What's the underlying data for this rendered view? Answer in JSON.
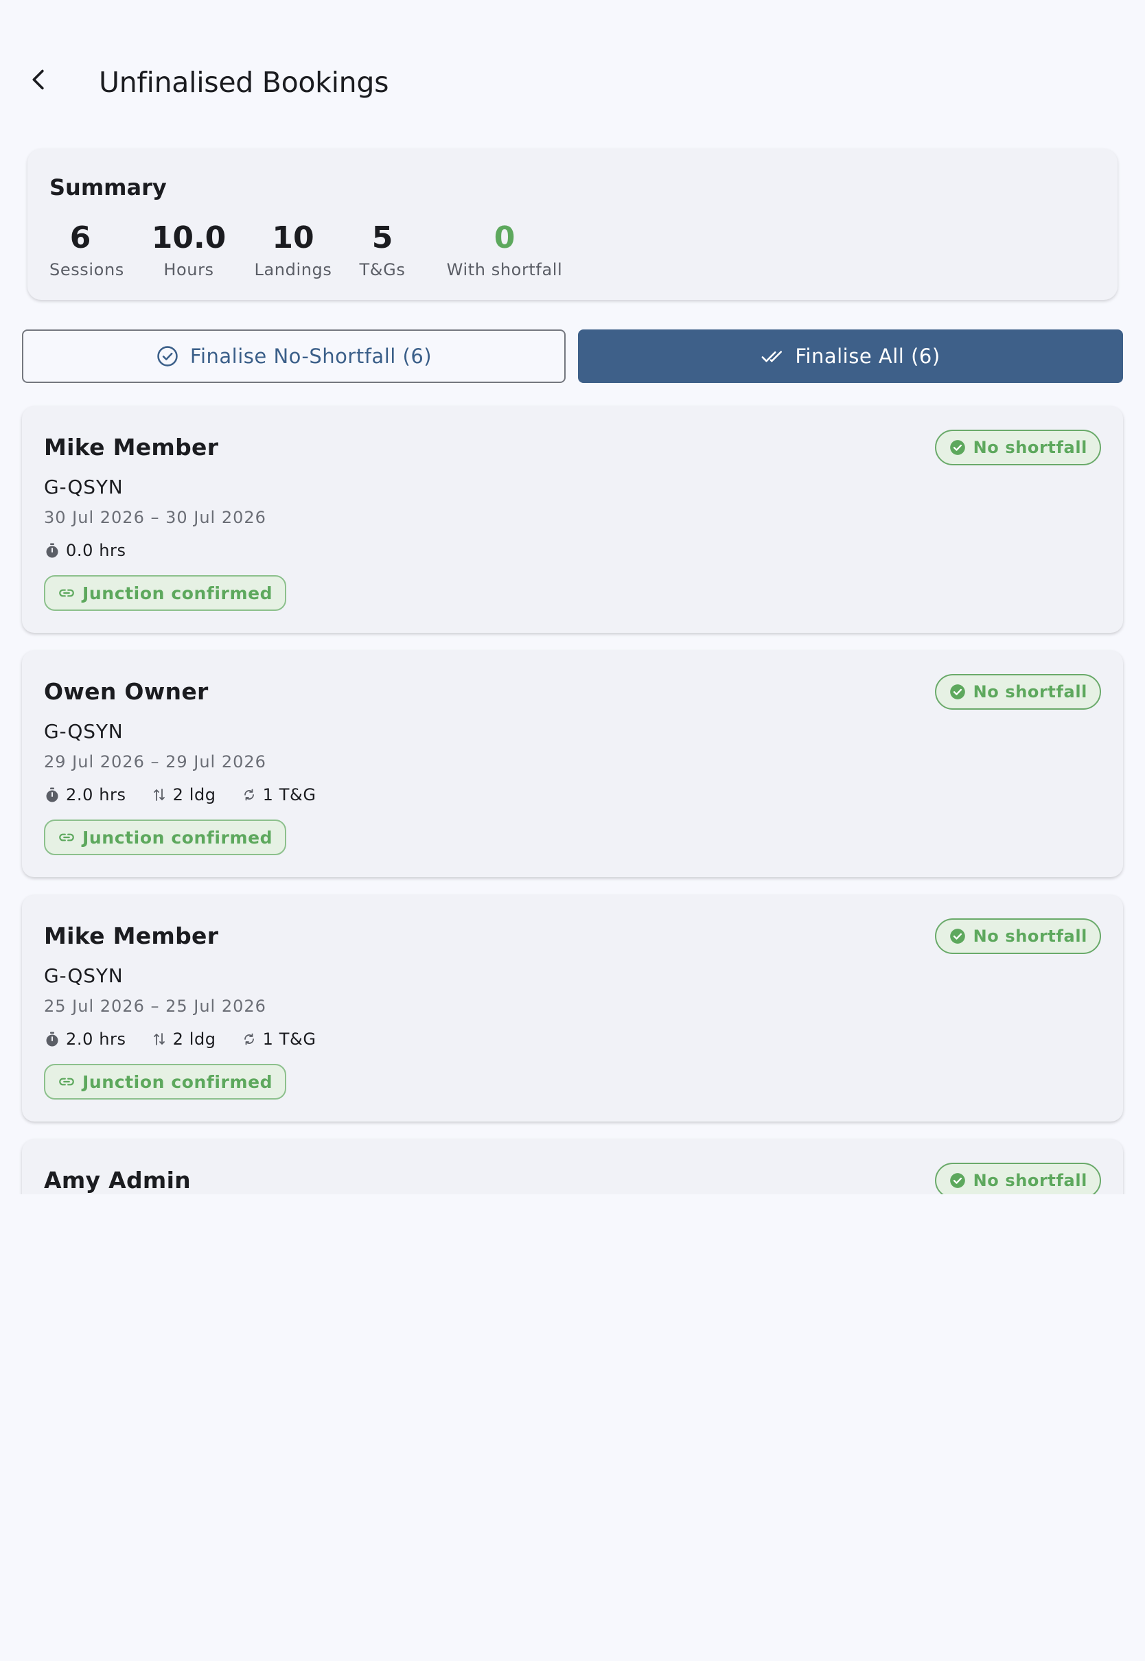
{
  "header": {
    "title": "Unfinalised Bookings",
    "back_icon": "arrow-back-icon"
  },
  "summary": {
    "title": "Summary",
    "stats": [
      {
        "value": "6",
        "label": "Sessions"
      },
      {
        "value": "10.0",
        "label": "Hours"
      },
      {
        "value": "10",
        "label": "Landings"
      },
      {
        "value": "5",
        "label": "T&Gs"
      },
      {
        "value": "0",
        "label": "With shortfall"
      }
    ],
    "shortfall_color": "#5da85d"
  },
  "actions": {
    "finalise_no_shortfall": "Finalise No-Shortfall (6)",
    "finalise_all": "Finalise All (6)"
  },
  "colors": {
    "primary": "#3e6089",
    "success": "#5da85d",
    "background": "#f7f8fd"
  },
  "bookings": [
    {
      "member": "Mike Member",
      "status": "No shortfall",
      "aircraft": "G-QSYN",
      "dates": "30 Jul 2026 – 30 Jul 2026",
      "hours": "0.0 hrs",
      "landings": "",
      "tgs": "",
      "junction": "Junction confirmed"
    },
    {
      "member": "Owen Owner",
      "status": "No shortfall",
      "aircraft": "G-QSYN",
      "dates": "29 Jul 2026 – 29 Jul 2026",
      "hours": "2.0 hrs",
      "landings": "2 ldg",
      "tgs": "1 T&G",
      "junction": "Junction confirmed"
    },
    {
      "member": "Mike Member",
      "status": "No shortfall",
      "aircraft": "G-QSYN",
      "dates": "25 Jul 2026 – 25 Jul 2026",
      "hours": "2.0 hrs",
      "landings": "2 ldg",
      "tgs": "1 T&G",
      "junction": "Junction confirmed"
    },
    {
      "member": "Amy Admin",
      "status": "No shortfall",
      "aircraft": "",
      "dates": "",
      "hours": "",
      "landings": "",
      "tgs": "",
      "junction": ""
    }
  ]
}
